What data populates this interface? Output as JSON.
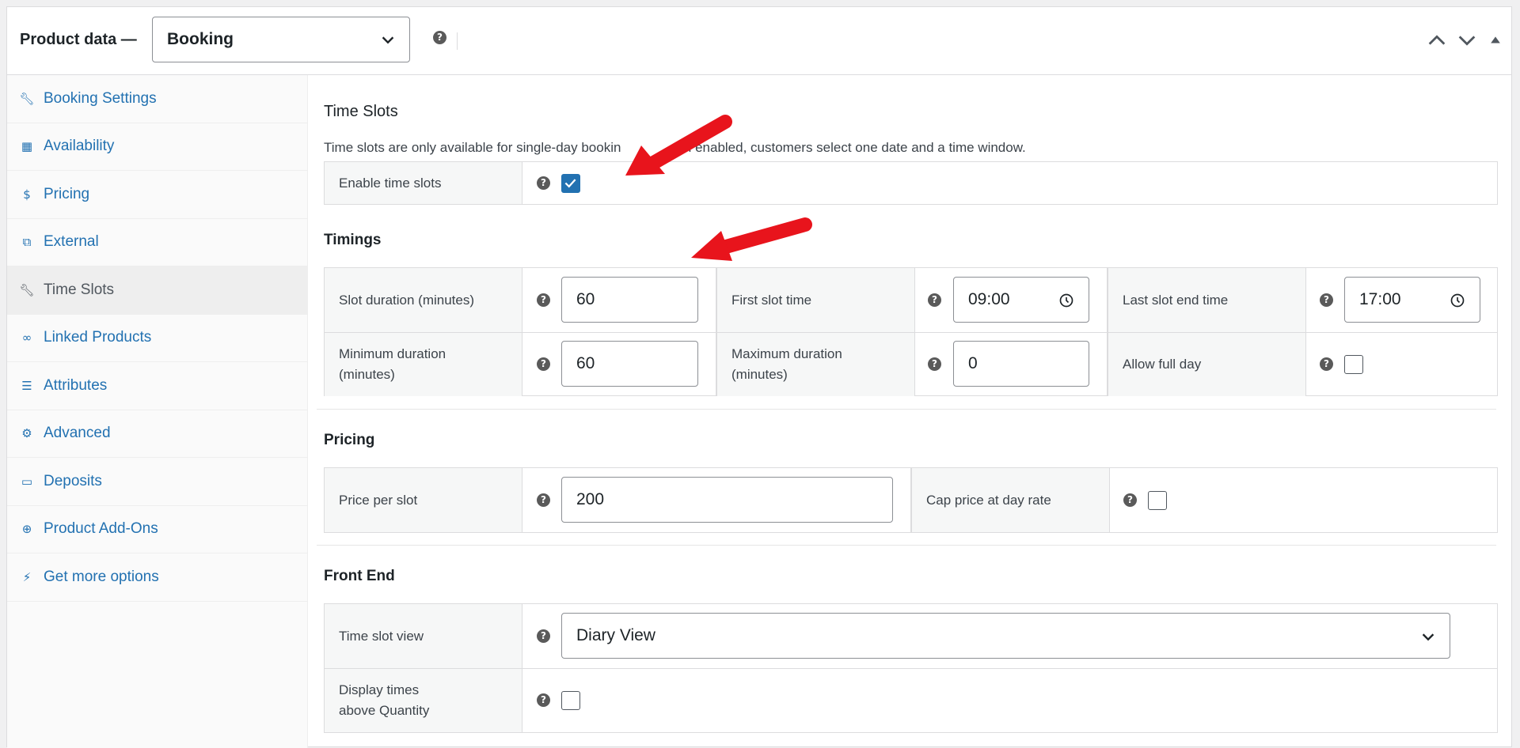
{
  "header": {
    "title": "Product data —",
    "product_type": "Booking",
    "help_icon": "question-circle-icon",
    "buttons": [
      "chevron-up-icon",
      "chevron-down-icon",
      "triangle-up-icon"
    ]
  },
  "sidebar": {
    "items": [
      {
        "label": "Booking Settings",
        "icon": "wrench-icon"
      },
      {
        "label": "Availability",
        "icon": "calendar-icon"
      },
      {
        "label": "Pricing",
        "icon": "dollar-circle-icon"
      },
      {
        "label": "External",
        "icon": "external-link-icon"
      },
      {
        "label": "Time Slots",
        "icon": "wrench-icon",
        "active": true
      },
      {
        "label": "Linked Products",
        "icon": "link-icon"
      },
      {
        "label": "Attributes",
        "icon": "list-icon"
      },
      {
        "label": "Advanced",
        "icon": "gear-icon"
      },
      {
        "label": "Deposits",
        "icon": "card-icon"
      },
      {
        "label": "Product Add-Ons",
        "icon": "plus-circle-icon"
      },
      {
        "label": "Get more options",
        "icon": "plugin-icon"
      }
    ]
  },
  "time_slots": {
    "title": "Time Slots",
    "description": "Time slots are only available for single-day bookin",
    "description_tail": "en enabled, customers select one date and a time window.",
    "enable_label": "Enable time slots",
    "enable_checked": true
  },
  "timings": {
    "title": "Timings",
    "slot_duration_label": "Slot duration (minutes)",
    "slot_duration_value": "60",
    "first_slot_label": "First slot time",
    "first_slot_value": "09:00",
    "last_slot_label": "Last slot end time",
    "last_slot_value": "17:00",
    "min_duration_label_1": "Minimum duration",
    "min_duration_label_2": "(minutes)",
    "min_duration_value": "60",
    "max_duration_label_1": "Maximum duration",
    "max_duration_label_2": "(minutes)",
    "max_duration_value": "0",
    "allow_full_day_label": "Allow full day",
    "allow_full_day_checked": false
  },
  "pricing": {
    "title": "Pricing",
    "price_per_slot_label": "Price per slot",
    "price_per_slot_value": "200",
    "cap_label": "Cap price at day rate",
    "cap_checked": false
  },
  "front_end": {
    "title": "Front End",
    "view_label": "Time slot view",
    "view_value": "Diary View",
    "display_times_label_1": "Display times",
    "display_times_label_2": "above Quantity",
    "display_times_checked": false
  },
  "colors": {
    "accent": "#2271b1",
    "arrow": "#e8141c"
  }
}
